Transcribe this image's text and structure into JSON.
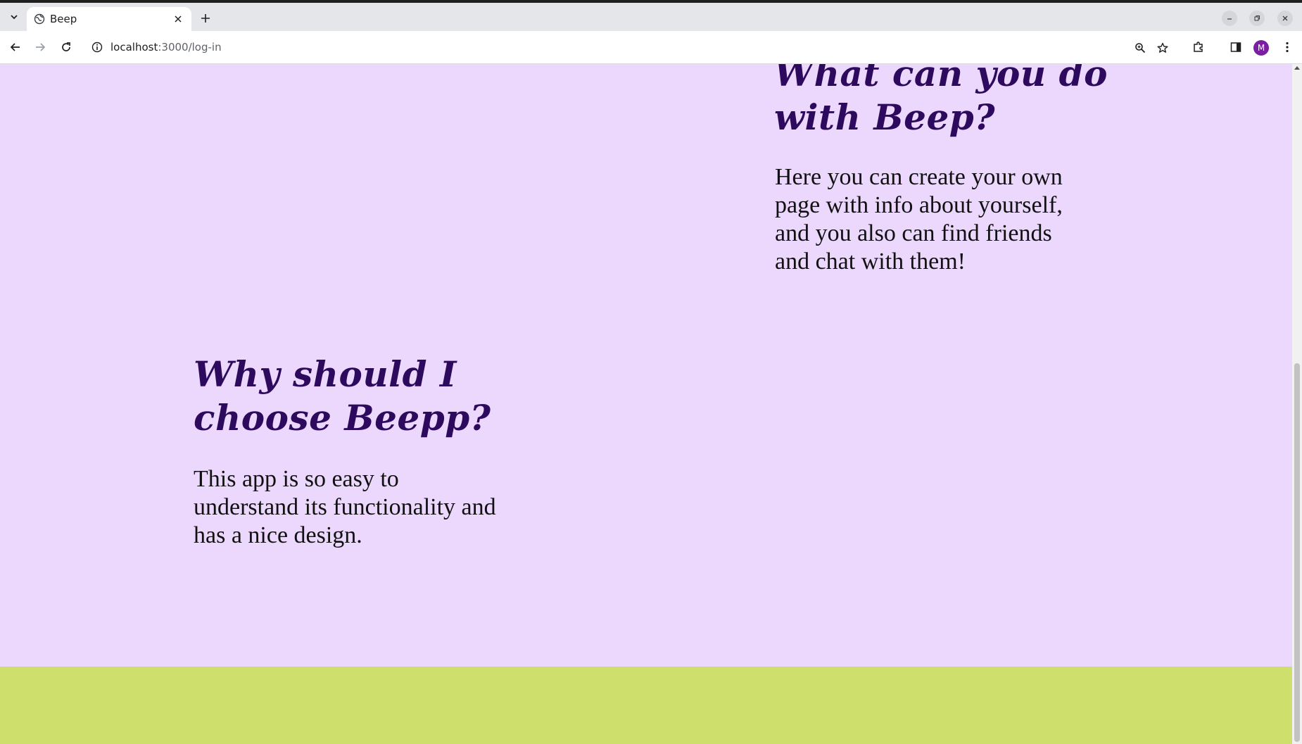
{
  "browser": {
    "tab": {
      "title": "Beep"
    },
    "url": {
      "host": "localhost",
      "path": ":3000/log-in"
    },
    "profile_initial": "M"
  },
  "page": {
    "section_what": {
      "heading_line1": "What can you do",
      "heading_line2": "with Beep?",
      "body_lines": [
        "Here you can create your own",
        "page with info about yourself,",
        "and you also can find friends",
        "and chat with them!"
      ]
    },
    "section_why": {
      "heading_line1": "Why should I",
      "heading_line2": "choose Beepp?",
      "body_lines": [
        "This app is so easy to",
        "understand its functionality and",
        "has a nice design."
      ]
    }
  },
  "colors": {
    "page_background": "#ecd8fc",
    "footer_band": "#cfdf6b",
    "heading": "#2e0a5e",
    "body_text": "#111111",
    "avatar": "#7b1fa2"
  },
  "icons": {
    "tab_menu": "chevron-down-icon",
    "tab_favicon": "globe-icon",
    "tab_close": "close-icon",
    "new_tab": "plus-icon",
    "minimize": "minimize-icon",
    "restore": "restore-icon",
    "window_close": "close-icon",
    "back": "arrow-left-icon",
    "forward": "arrow-right-icon",
    "reload": "reload-icon",
    "site_info": "info-icon",
    "zoom": "zoom-icon",
    "bookmark": "star-icon",
    "extensions": "puzzle-icon",
    "side_panel": "side-panel-icon",
    "menu": "kebab-menu-icon"
  }
}
